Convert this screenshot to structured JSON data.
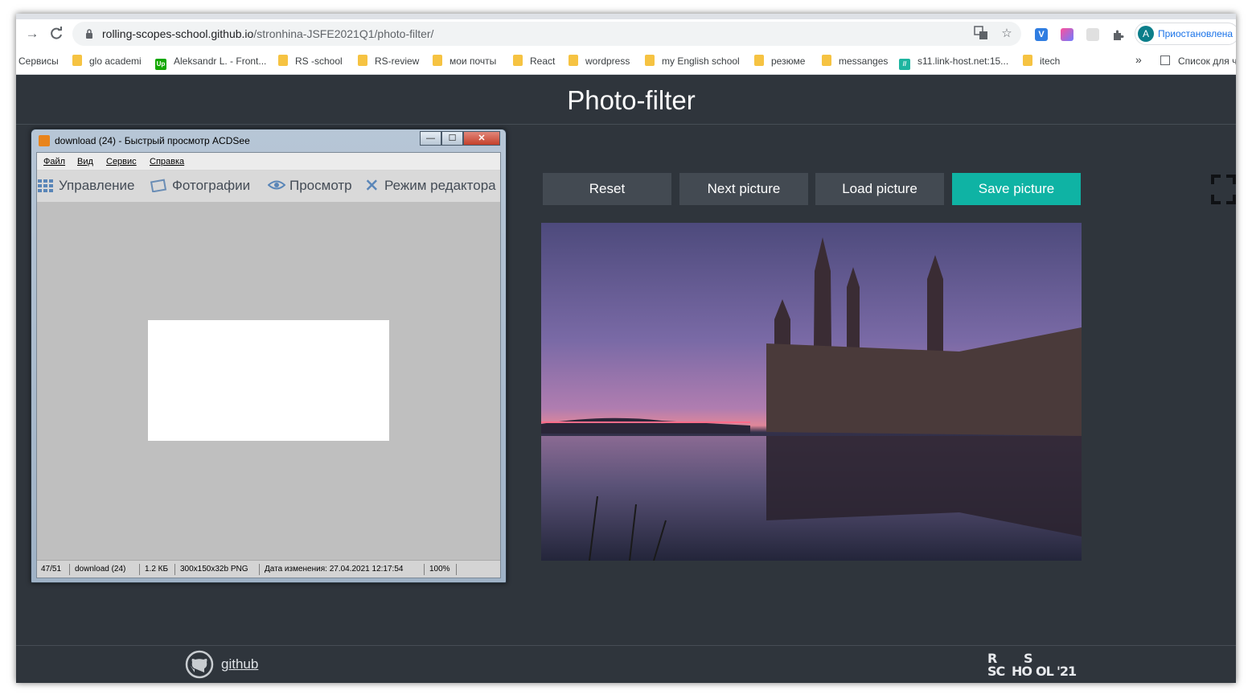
{
  "browser": {
    "url_host": "rolling-scopes-school.github.io",
    "url_path": "/stronhina-JSFE2021Q1/photo-filter/",
    "profile_initial": "A",
    "profile_label": "Приостановлена",
    "icons": [
      "back-icon",
      "reload-icon",
      "lock-icon",
      "translate-icon",
      "star-icon",
      "extensions-icon",
      "reading-list-icon"
    ],
    "bookmarks": [
      {
        "label": "Сервисы",
        "kind": "apps"
      },
      {
        "label": "glo academi",
        "kind": "folder"
      },
      {
        "label": "Aleksandr L. - Front...",
        "kind": "upwork",
        "badge": "Up"
      },
      {
        "label": "RS -school",
        "kind": "folder"
      },
      {
        "label": "RS-review",
        "kind": "folder"
      },
      {
        "label": "мои почты",
        "kind": "folder"
      },
      {
        "label": "React",
        "kind": "folder"
      },
      {
        "label": "wordpress",
        "kind": "folder"
      },
      {
        "label": "my English school",
        "kind": "folder"
      },
      {
        "label": "резюме",
        "kind": "folder"
      },
      {
        "label": "messanges",
        "kind": "folder"
      },
      {
        "label": "s11.link-host.net:15...",
        "kind": "site",
        "badge": "//"
      },
      {
        "label": "itech",
        "kind": "folder"
      }
    ],
    "bookmarks_overflow": "»",
    "reading_list_label": "Список для ч"
  },
  "page": {
    "title": "Photo-filter",
    "buttons": {
      "reset": "Reset",
      "next": "Next picture",
      "load": "Load picture",
      "save": "Save picture"
    },
    "footer": {
      "github_label": "github",
      "logo_letters": [
        "R",
        "S",
        "SC",
        "HO",
        "OL",
        "'21"
      ]
    },
    "colors": {
      "background": "#2f353c",
      "button": "#434a52",
      "accent": "#0fb3a4"
    }
  },
  "acdsee": {
    "title": "download (24) - Быстрый просмотр ACDSee",
    "window_buttons": {
      "minimize": "—",
      "maximize": "☐",
      "close": "✕"
    },
    "menu": {
      "file": "Файл",
      "view": "Вид",
      "service": "Сервис",
      "help": "Справка"
    },
    "modes": {
      "manage": "Управление",
      "photos": "Фотографии",
      "view": "Просмотр",
      "edit": "Режим редактора"
    },
    "status": {
      "index": "47/51",
      "filename": "download (24)",
      "size": "1.2 КБ",
      "dims": "300x150x32b PNG",
      "modified": "Дата изменения: 27.04.2021 12:17:54",
      "zoom": "100%"
    }
  }
}
